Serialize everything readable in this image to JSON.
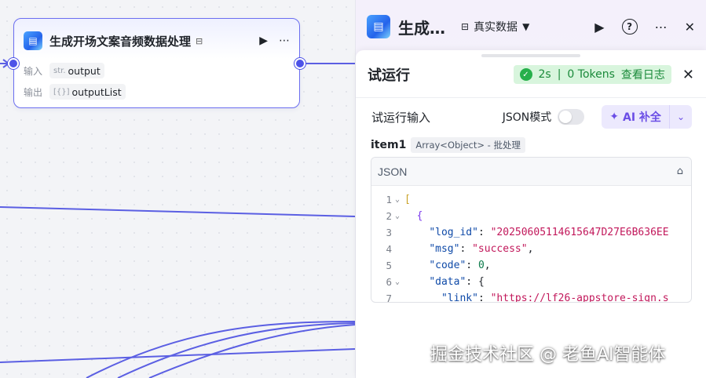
{
  "node": {
    "title": "生成开场文案音频数据处理",
    "input_label": "输入",
    "input_type": "str.",
    "input_name": "output",
    "output_label": "输出",
    "output_type": "[{}]",
    "output_name": "outputList"
  },
  "panel": {
    "title": "生成…",
    "data_mode": "真实数据"
  },
  "drawer": {
    "title": "试运行",
    "status_time": "2s",
    "status_tokens": "0 Tokens",
    "view_log": "查看日志",
    "input_section_title": "试运行输入",
    "json_mode_label": "JSON模式",
    "ai_button_label": "AI 补全",
    "item_name": "item1",
    "item_type": "Array<Object> - 批处理",
    "editor_label": "JSON"
  },
  "code_lines": [
    {
      "n": "1",
      "text": "["
    },
    {
      "n": "2",
      "text": "  {"
    },
    {
      "n": "3",
      "key": "\"log_id\"",
      "val": "\"20250605114615647D27E6B636EE"
    },
    {
      "n": "4",
      "key": "\"msg\"",
      "val": "\"success\""
    },
    {
      "n": "5",
      "key": "\"code\"",
      "val": "0"
    },
    {
      "n": "6",
      "key": "\"data\"",
      "val": "{"
    },
    {
      "n": "7",
      "key": "\"link\"",
      "val": "\"https://lf26-appstore-sign.s"
    }
  ],
  "watermark": "掘金技术社区 @ 老鱼AI智能体",
  "colors": {
    "accent": "#4d53e8",
    "success_bg": "#d8f5dd",
    "success_text": "#1a8a3a",
    "ai_purple": "#6b4ee6"
  }
}
